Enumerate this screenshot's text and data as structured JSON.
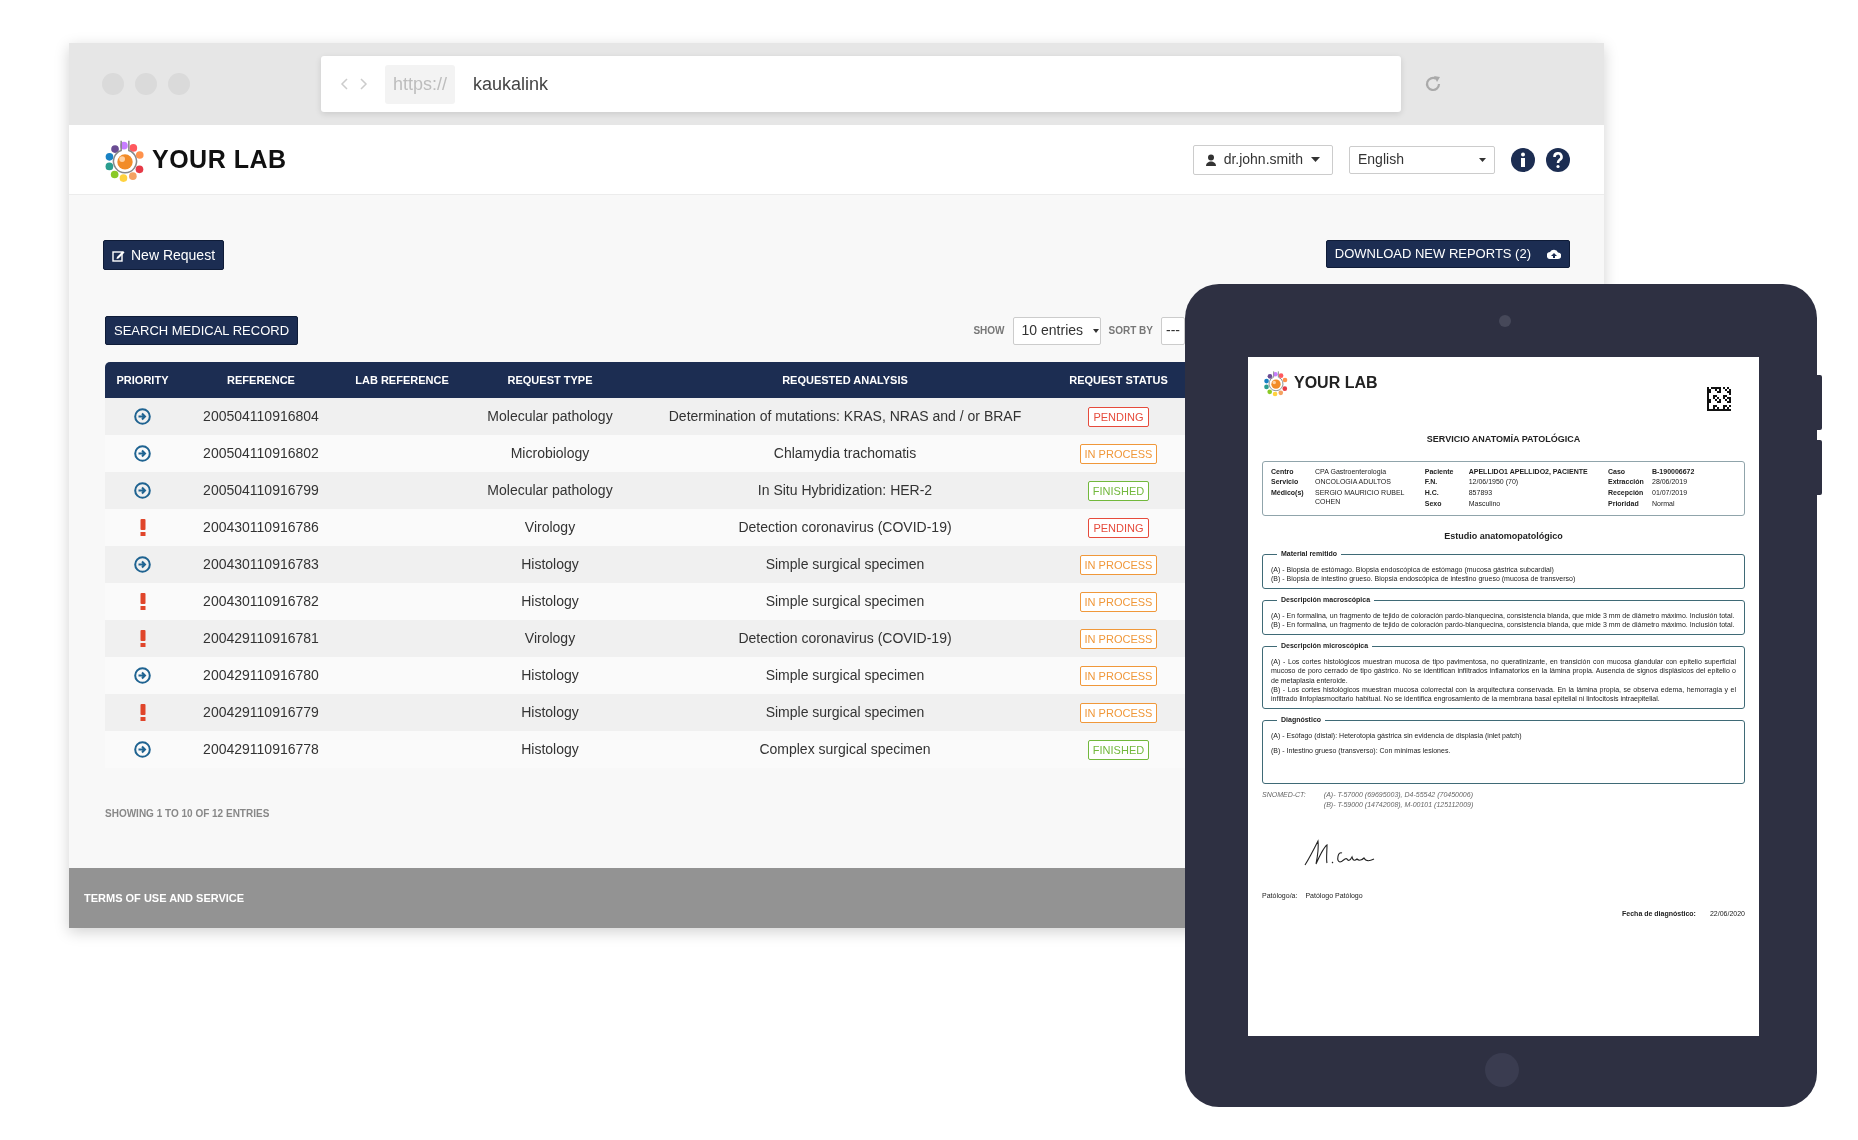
{
  "browser": {
    "protocol": "https://",
    "address": "kaukalink"
  },
  "header": {
    "logo_text": "YOUR LAB",
    "user": "dr.john.smith",
    "language": "English"
  },
  "toolbar": {
    "new_request": "New Request",
    "download": "DOWNLOAD NEW REPORTS (2)",
    "search": "SEARCH MEDICAL RECORD",
    "show_label": "SHOW",
    "show_value": "10 entries",
    "sort_label": "SORT BY",
    "sort_value": "---"
  },
  "table": {
    "columns": [
      "PRIORITY",
      "REFERENCE",
      "LAB REFERENCE",
      "REQUEST TYPE",
      "REQUESTED ANALYSIS",
      "REQUEST STATUS"
    ],
    "rows": [
      {
        "priority": {
          "kind": "normal"
        },
        "reference": "200504110916804",
        "request_type": "Molecular pathology",
        "analysis": "Determination of mutations: KRAS, NRAS and / or BRAF",
        "status": {
          "text": "PENDING",
          "kind": "pending"
        }
      },
      {
        "priority": {
          "kind": "normal"
        },
        "reference": "200504110916802",
        "request_type": "Microbiology",
        "analysis": "Chlamydia trachomatis",
        "status": {
          "text": "IN PROCESS",
          "kind": "in_process"
        }
      },
      {
        "priority": {
          "kind": "normal"
        },
        "reference": "200504110916799",
        "request_type": "Molecular pathology",
        "analysis": "In Situ Hybridization: HER-2",
        "status": {
          "text": "FINISHED",
          "kind": "finished"
        }
      },
      {
        "priority": {
          "kind": "urgent"
        },
        "reference": "200430110916786",
        "request_type": "Virology",
        "analysis": "Detection coronavirus (COVID-19)",
        "status": {
          "text": "PENDING",
          "kind": "pending"
        }
      },
      {
        "priority": {
          "kind": "normal"
        },
        "reference": "200430110916783",
        "request_type": "Histology",
        "analysis": "Simple surgical specimen",
        "status": {
          "text": "IN PROCESS",
          "kind": "in_process"
        }
      },
      {
        "priority": {
          "kind": "urgent"
        },
        "reference": "200430110916782",
        "request_type": "Histology",
        "analysis": "Simple surgical specimen",
        "status": {
          "text": "IN PROCESS",
          "kind": "in_process"
        }
      },
      {
        "priority": {
          "kind": "urgent"
        },
        "reference": "200429110916781",
        "request_type": "Virology",
        "analysis": "Detection coronavirus (COVID-19)",
        "status": {
          "text": "IN PROCESS",
          "kind": "in_process"
        }
      },
      {
        "priority": {
          "kind": "normal"
        },
        "reference": "200429110916780",
        "request_type": "Histology",
        "analysis": "Simple surgical specimen",
        "status": {
          "text": "IN PROCESS",
          "kind": "in_process"
        }
      },
      {
        "priority": {
          "kind": "urgent"
        },
        "reference": "200429110916779",
        "request_type": "Histology",
        "analysis": "Simple surgical specimen",
        "status": {
          "text": "IN PROCESS",
          "kind": "in_process"
        }
      },
      {
        "priority": {
          "kind": "normal"
        },
        "reference": "200429110916778",
        "request_type": "Histology",
        "analysis": "Complex surgical specimen",
        "status": {
          "text": "FINISHED",
          "kind": "finished"
        }
      }
    ]
  },
  "table_info": "SHOWING 1 TO 10 OF 12 ENTRIES",
  "footer": "TERMS OF USE AND SERVICE",
  "report": {
    "logo_text": "YOUR LAB",
    "title": "SERVICIO ANATOMÍA PATOLÓGICA",
    "info_columns": [
      [
        {
          "label": "Centro",
          "value": "CPA Gastroenterologia",
          "bold": false
        },
        {
          "label": "Servicio",
          "value": "ONCOLOGIA ADULTOS",
          "bold": false
        },
        {
          "label": "Médico(s)",
          "value": "SERGIO MAURICIO RUBEL COHEN",
          "bold": false
        }
      ],
      [
        {
          "label": "Paciente",
          "value": "APELLIDO1 APELLIDO2, PACIENTE",
          "bold": true
        },
        {
          "label": "F.N.",
          "value": "12/06/1950 (70)",
          "bold": false
        },
        {
          "label": "H.C.",
          "value": "857893",
          "bold": false
        },
        {
          "label": "Sexo",
          "value": "Masculino",
          "bold": false
        }
      ],
      [
        {
          "label": "Caso",
          "value": "B-190006672",
          "bold": true
        },
        {
          "label": "Extracción",
          "value": "28/06/2019",
          "bold": false
        },
        {
          "label": "Recepción",
          "value": "01/07/2019",
          "bold": false
        },
        {
          "label": "Prioridad",
          "value": "Normal",
          "bold": false
        }
      ]
    ],
    "study_title": "Estudio anatomopatológico",
    "sections": [
      {
        "title": "Material remitido",
        "paragraphs": [
          "(A) - Biopsia de estómago. Biopsia endoscópica de estómago (mucosa gástrica subcardial)",
          "(B) - Biopsia de intestino grueso. Biopsia endoscópica de intestino grueso (mucosa de transverso)"
        ]
      },
      {
        "title": "Descripción macroscópica",
        "paragraphs": [
          "(A) - En formalina, un fragmento de tejido de coloración pardo-blanquecina, consistencia blanda, que mide 3 mm de diámetro máximo. Inclusión total.",
          "(B) - En formalina, un fragmento de tejido de coloración pardo-blanquecina, consistencia blanda, que mide 3 mm de diámetro máximo. Inclusión total."
        ]
      },
      {
        "title": "Descripción microscópica",
        "paragraphs": [
          "(A) - Los cortes histológicos muestran mucosa de tipo pavimentosa, no queratinizante, en transición con mucosa glandular con epitelio superficial mucoso de poro cerrado de tipo gástrico. No se identifican infiltrados inflamatorios en la lámina propia. Ausencia de signos displásicos del epitelio o de metaplasia enteroide.",
          "(B) - Los cortes histológicos muestran mucosa colorrectal con la arquitectura conservada. En la lámina propia, se observa edema, hemorragia y el infiltrado linfoplasmocitario habitual. No se identifica engrosamiento de la membrana basal epitelial ni linfocitosis intraepitelial."
        ]
      },
      {
        "title": "Diagnóstico",
        "paragraphs": [
          "(A) - Esófago (distal): Heterotopia gástrica sin evidencia de displasia (inlet patch)",
          "(B) - Intestino grueso (transverso): Con mínimas lesiones."
        ]
      }
    ],
    "snomed": {
      "label": "SNOMED-CT:",
      "lines": [
        "(A)- T-57000 (69695003), D4-55542 (70450006)",
        "(B)- T-59000 (14742008), M-00101 (125112009)"
      ]
    },
    "pathologist": {
      "label": "Patólogo/a:",
      "value": "Patólogo Patólogo"
    },
    "diagnosis_date": {
      "label": "Fecha de diagnóstico:",
      "value": "22/06/2020"
    }
  }
}
